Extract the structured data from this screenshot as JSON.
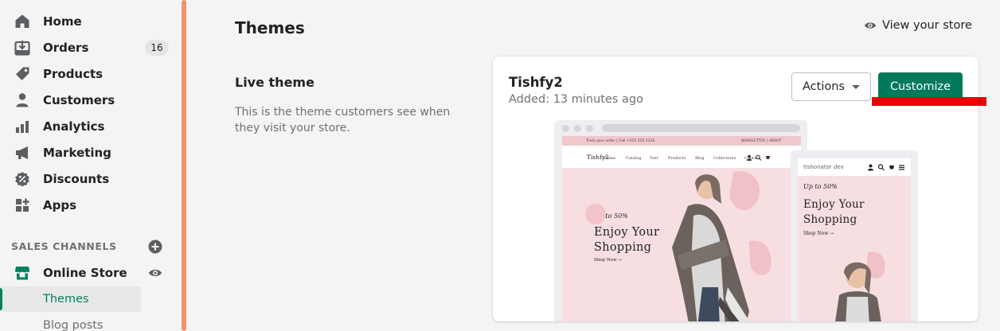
{
  "nav": {
    "items": [
      {
        "label": "Home",
        "icon": "home-icon"
      },
      {
        "label": "Orders",
        "icon": "orders-icon",
        "badge": "16"
      },
      {
        "label": "Products",
        "icon": "tag-icon"
      },
      {
        "label": "Customers",
        "icon": "person-icon"
      },
      {
        "label": "Analytics",
        "icon": "bar-chart-icon"
      },
      {
        "label": "Marketing",
        "icon": "megaphone-icon"
      },
      {
        "label": "Discounts",
        "icon": "discount-icon"
      },
      {
        "label": "Apps",
        "icon": "apps-icon"
      }
    ],
    "sales_channels_title": "SALES CHANNELS",
    "online_store": "Online Store",
    "sub_items": [
      "Themes",
      "Blog posts"
    ]
  },
  "header": {
    "title": "Themes",
    "view_store": "View your store"
  },
  "live_theme": {
    "title": "Live theme",
    "description": "This is the theme customers see when they visit your store."
  },
  "theme_card": {
    "name": "Tishfy2",
    "added": "Added: 13 minutes ago",
    "actions_label": "Actions",
    "customize_label": "Customize"
  },
  "preview": {
    "announcement_left": "Track your order  |  Call +555 555-1234",
    "announcement_right": "NEWSLETTER  |  ABOUT",
    "logo": "Tishfy2",
    "menu": [
      "Home",
      "Catalog",
      "Test",
      "Products",
      "Blog",
      "Collections",
      "Contact"
    ],
    "promo": "Up to 50%",
    "headline": "Enjoy Your Shopping",
    "cta": "Shop Now →",
    "mobile_store_name": "tishonator dev"
  },
  "colors": {
    "primary": "#007a5a",
    "accent": "#f0926b",
    "hero_bg": "#f7dfe1",
    "annotation": "#e8000b"
  }
}
